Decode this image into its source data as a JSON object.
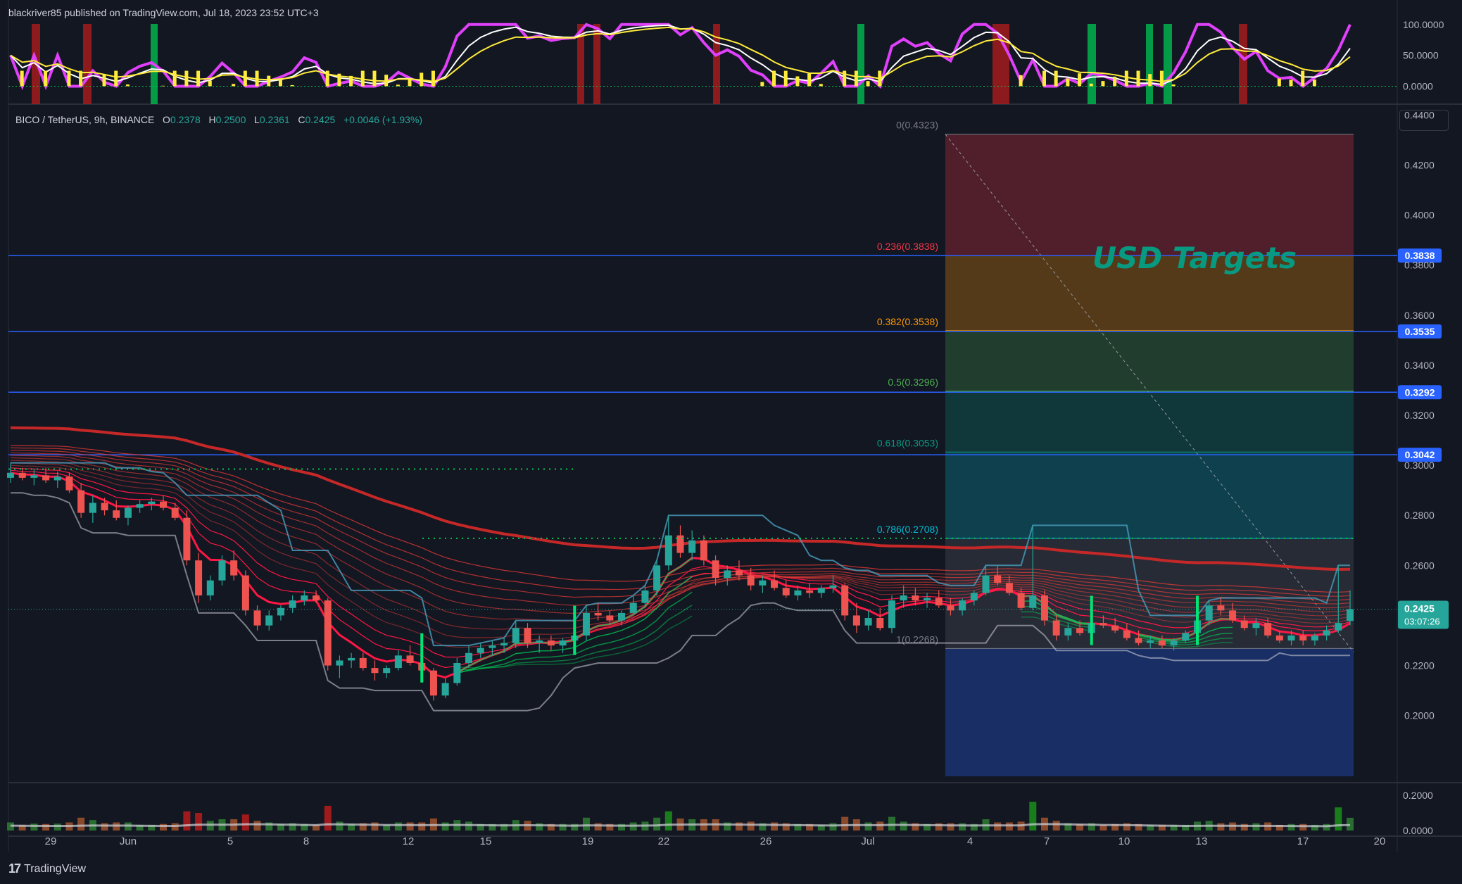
{
  "header": {
    "publish_line": "blackriver85 published on TradingView.com, Jul 18, 2023 23:52 UTC+3",
    "symbol": "BICO / TetherUS, 9h, BINANCE",
    "open_label": "O",
    "open": "0.2378",
    "high_label": "H",
    "high": "0.2500",
    "low_label": "L",
    "low": "0.2361",
    "close_label": "C",
    "close": "0.2425",
    "change": "+0.0046 (+1.93%)"
  },
  "footer": {
    "brand": "TradingView",
    "logo_glyph": "17"
  },
  "annotation": {
    "title": "USD Targets"
  },
  "colors": {
    "background": "#131722",
    "bull": "#26a69a",
    "bear": "#ef5350",
    "fib_line": "#2962ff",
    "ribbon_red": "#e53935",
    "ribbon_green": "#00c853"
  },
  "chart_data": {
    "type": "candlestick",
    "price_axis": {
      "ticks": [
        "0.4400",
        "0.4200",
        "0.4000",
        "0.3800",
        "0.3600",
        "0.3400",
        "0.3200",
        "0.3000",
        "0.2800",
        "0.2600",
        "0.2400",
        "0.2200",
        "0.2000"
      ],
      "range": [
        0.185,
        0.455
      ],
      "price_labels": [
        {
          "value": 0.3838,
          "text": "0.3838"
        },
        {
          "value": 0.3535,
          "text": "0.3535"
        },
        {
          "value": 0.3292,
          "text": "0.3292"
        },
        {
          "value": 0.3042,
          "text": "0.3042"
        }
      ],
      "last_price": "0.2425",
      "countdown": "03:07:26"
    },
    "time_axis": {
      "labels": [
        "29",
        "Jun",
        "5",
        "8",
        "12",
        "15",
        "19",
        "22",
        "26",
        "Jul",
        "4",
        "7",
        "10",
        "13",
        "17",
        "20"
      ]
    },
    "fib_levels": [
      {
        "ratio": "0",
        "value": 0.4323,
        "text": "0(0.4323)",
        "color": "#787b86"
      },
      {
        "ratio": "0.236",
        "value": 0.3838,
        "text": "0.236(0.3838)",
        "color": "#f23645"
      },
      {
        "ratio": "0.382",
        "value": 0.3538,
        "text": "0.382(0.3538)",
        "color": "#ff9800"
      },
      {
        "ratio": "0.5",
        "value": 0.3296,
        "text": "0.5(0.3296)",
        "color": "#4caf50"
      },
      {
        "ratio": "0.618",
        "value": 0.3053,
        "text": "0.618(0.3053)",
        "color": "#089981"
      },
      {
        "ratio": "0.786",
        "value": 0.2708,
        "text": "0.786(0.2708)",
        "color": "#00bcd4"
      },
      {
        "ratio": "1",
        "value": 0.2268,
        "text": "1(0.2268)",
        "color": "#787b86"
      }
    ],
    "oscillator_axis": {
      "ticks": [
        "100.0000",
        "50.0000",
        "0.0000"
      ],
      "range": [
        -20,
        110
      ]
    },
    "volume_axis": {
      "ticks": [
        "0.2000",
        "0.0000"
      ],
      "range": [
        0,
        0.26
      ]
    },
    "candles": [
      [
        0.295,
        0.301,
        0.293,
        0.297
      ],
      [
        0.297,
        0.299,
        0.294,
        0.295
      ],
      [
        0.295,
        0.2985,
        0.292,
        0.296
      ],
      [
        0.296,
        0.299,
        0.293,
        0.294
      ],
      [
        0.294,
        0.2975,
        0.291,
        0.2955
      ],
      [
        0.2955,
        0.297,
        0.289,
        0.29
      ],
      [
        0.29,
        0.293,
        0.279,
        0.281
      ],
      [
        0.281,
        0.288,
        0.277,
        0.285
      ],
      [
        0.285,
        0.287,
        0.28,
        0.282
      ],
      [
        0.282,
        0.286,
        0.278,
        0.279
      ],
      [
        0.279,
        0.284,
        0.276,
        0.283
      ],
      [
        0.283,
        0.286,
        0.281,
        0.2845
      ],
      [
        0.2845,
        0.287,
        0.282,
        0.2855
      ],
      [
        0.2855,
        0.288,
        0.282,
        0.283
      ],
      [
        0.283,
        0.285,
        0.278,
        0.279
      ],
      [
        0.279,
        0.282,
        0.26,
        0.262
      ],
      [
        0.262,
        0.265,
        0.245,
        0.248
      ],
      [
        0.248,
        0.256,
        0.246,
        0.254
      ],
      [
        0.254,
        0.264,
        0.252,
        0.262
      ],
      [
        0.262,
        0.266,
        0.254,
        0.256
      ],
      [
        0.256,
        0.258,
        0.24,
        0.242
      ],
      [
        0.242,
        0.244,
        0.234,
        0.236
      ],
      [
        0.236,
        0.242,
        0.234,
        0.24
      ],
      [
        0.24,
        0.244,
        0.238,
        0.243
      ],
      [
        0.243,
        0.248,
        0.241,
        0.246
      ],
      [
        0.246,
        0.25,
        0.244,
        0.248
      ],
      [
        0.248,
        0.25,
        0.245,
        0.246
      ],
      [
        0.246,
        0.247,
        0.218,
        0.22
      ],
      [
        0.22,
        0.224,
        0.215,
        0.222
      ],
      [
        0.222,
        0.225,
        0.219,
        0.223
      ],
      [
        0.223,
        0.225,
        0.218,
        0.219
      ],
      [
        0.219,
        0.222,
        0.214,
        0.217
      ],
      [
        0.217,
        0.22,
        0.215,
        0.219
      ],
      [
        0.219,
        0.226,
        0.218,
        0.224
      ],
      [
        0.224,
        0.228,
        0.22,
        0.221
      ],
      [
        0.221,
        0.224,
        0.216,
        0.218
      ],
      [
        0.218,
        0.219,
        0.206,
        0.208
      ],
      [
        0.208,
        0.215,
        0.207,
        0.213
      ],
      [
        0.213,
        0.223,
        0.212,
        0.221
      ],
      [
        0.221,
        0.228,
        0.219,
        0.225
      ],
      [
        0.225,
        0.229,
        0.223,
        0.227
      ],
      [
        0.227,
        0.23,
        0.224,
        0.228
      ],
      [
        0.228,
        0.231,
        0.225,
        0.229
      ],
      [
        0.229,
        0.238,
        0.227,
        0.235
      ],
      [
        0.235,
        0.237,
        0.227,
        0.229
      ],
      [
        0.229,
        0.232,
        0.225,
        0.23
      ],
      [
        0.23,
        0.232,
        0.226,
        0.228
      ],
      [
        0.228,
        0.231,
        0.225,
        0.23
      ],
      [
        0.23,
        0.233,
        0.227,
        0.232
      ],
      [
        0.232,
        0.244,
        0.23,
        0.241
      ],
      [
        0.241,
        0.245,
        0.238,
        0.24
      ],
      [
        0.24,
        0.242,
        0.236,
        0.238
      ],
      [
        0.238,
        0.242,
        0.236,
        0.241
      ],
      [
        0.241,
        0.248,
        0.24,
        0.245
      ],
      [
        0.245,
        0.252,
        0.243,
        0.25
      ],
      [
        0.25,
        0.262,
        0.248,
        0.26
      ],
      [
        0.26,
        0.28,
        0.258,
        0.272
      ],
      [
        0.272,
        0.276,
        0.263,
        0.265
      ],
      [
        0.265,
        0.274,
        0.262,
        0.27
      ],
      [
        0.27,
        0.272,
        0.26,
        0.262
      ],
      [
        0.262,
        0.264,
        0.252,
        0.255
      ],
      [
        0.255,
        0.26,
        0.252,
        0.258
      ],
      [
        0.258,
        0.262,
        0.254,
        0.256
      ],
      [
        0.256,
        0.259,
        0.25,
        0.252
      ],
      [
        0.252,
        0.256,
        0.249,
        0.254
      ],
      [
        0.254,
        0.258,
        0.25,
        0.251
      ],
      [
        0.251,
        0.254,
        0.247,
        0.248
      ],
      [
        0.248,
        0.252,
        0.246,
        0.25
      ],
      [
        0.25,
        0.253,
        0.247,
        0.249
      ],
      [
        0.249,
        0.252,
        0.247,
        0.251
      ],
      [
        0.251,
        0.256,
        0.249,
        0.252
      ],
      [
        0.252,
        0.253,
        0.238,
        0.24
      ],
      [
        0.24,
        0.245,
        0.233,
        0.236
      ],
      [
        0.236,
        0.242,
        0.234,
        0.239
      ],
      [
        0.239,
        0.243,
        0.234,
        0.235
      ],
      [
        0.235,
        0.248,
        0.233,
        0.246
      ],
      [
        0.246,
        0.252,
        0.243,
        0.248
      ],
      [
        0.248,
        0.251,
        0.244,
        0.246
      ],
      [
        0.246,
        0.249,
        0.243,
        0.247
      ],
      [
        0.247,
        0.25,
        0.243,
        0.244
      ],
      [
        0.244,
        0.247,
        0.24,
        0.242
      ],
      [
        0.242,
        0.247,
        0.24,
        0.246
      ],
      [
        0.246,
        0.25,
        0.244,
        0.249
      ],
      [
        0.249,
        0.26,
        0.248,
        0.256
      ],
      [
        0.256,
        0.26,
        0.252,
        0.253
      ],
      [
        0.253,
        0.256,
        0.248,
        0.249
      ],
      [
        0.249,
        0.251,
        0.242,
        0.243
      ],
      [
        0.243,
        0.276,
        0.242,
        0.248
      ],
      [
        0.248,
        0.25,
        0.236,
        0.238
      ],
      [
        0.238,
        0.24,
        0.23,
        0.232
      ],
      [
        0.232,
        0.237,
        0.23,
        0.235
      ],
      [
        0.235,
        0.238,
        0.232,
        0.233
      ],
      [
        0.233,
        0.238,
        0.231,
        0.237
      ],
      [
        0.237,
        0.24,
        0.235,
        0.236
      ],
      [
        0.236,
        0.239,
        0.233,
        0.234
      ],
      [
        0.234,
        0.237,
        0.23,
        0.231
      ],
      [
        0.231,
        0.234,
        0.228,
        0.229
      ],
      [
        0.229,
        0.232,
        0.227,
        0.23
      ],
      [
        0.23,
        0.232,
        0.227,
        0.228
      ],
      [
        0.228,
        0.231,
        0.226,
        0.23
      ],
      [
        0.23,
        0.234,
        0.229,
        0.233
      ],
      [
        0.233,
        0.24,
        0.231,
        0.238
      ],
      [
        0.238,
        0.246,
        0.236,
        0.244
      ],
      [
        0.244,
        0.247,
        0.24,
        0.242
      ],
      [
        0.242,
        0.245,
        0.237,
        0.238
      ],
      [
        0.238,
        0.24,
        0.234,
        0.235
      ],
      [
        0.235,
        0.239,
        0.232,
        0.237
      ],
      [
        0.237,
        0.239,
        0.231,
        0.232
      ],
      [
        0.232,
        0.234,
        0.229,
        0.23
      ],
      [
        0.23,
        0.234,
        0.228,
        0.232
      ],
      [
        0.232,
        0.234,
        0.228,
        0.23
      ],
      [
        0.23,
        0.233,
        0.228,
        0.232
      ],
      [
        0.232,
        0.236,
        0.23,
        0.234
      ],
      [
        0.234,
        0.26,
        0.233,
        0.237
      ],
      [
        0.2378,
        0.25,
        0.2361,
        0.2425
      ]
    ]
  }
}
